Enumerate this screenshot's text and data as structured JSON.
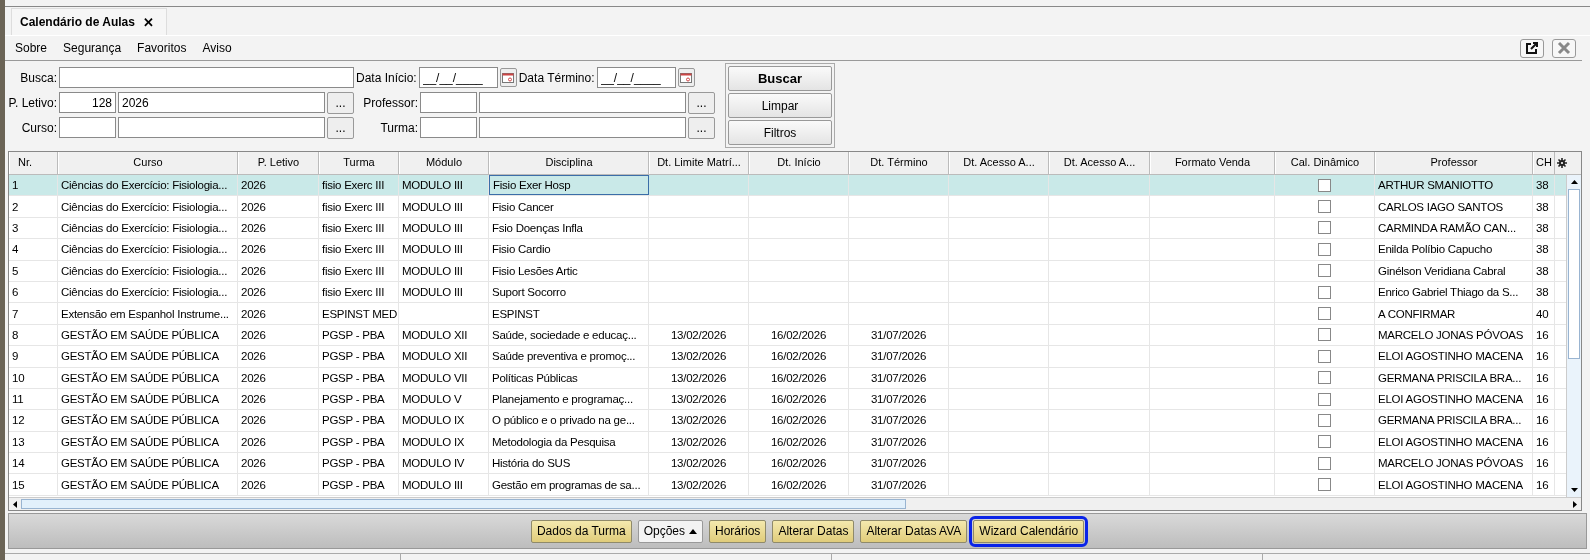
{
  "tab": {
    "title": "Calendário de Aulas",
    "close": "✕",
    "selected": true
  },
  "menu": [
    "Sobre",
    "Segurança",
    "Favoritos",
    "Aviso"
  ],
  "form": {
    "busca": {
      "label": "Busca:"
    },
    "data_inicio": {
      "label": "Data Início:",
      "value": "__/__/____"
    },
    "data_termino": {
      "label": "Data Término:",
      "value": "__/__/____"
    },
    "letivo": {
      "label": "P. Letivo:",
      "code": "128",
      "name": "2026",
      "browse": "..."
    },
    "professor": {
      "label": "Professor:",
      "browse": "..."
    },
    "curso": {
      "label": "Curso:",
      "browse": "..."
    },
    "turma": {
      "label": "Turma:",
      "browse": "..."
    }
  },
  "search_buttons": [
    {
      "label": "Buscar",
      "default": true
    },
    {
      "label": "Limpar",
      "default": false
    },
    {
      "label": "Filtros",
      "default": false
    }
  ],
  "table": {
    "columns": [
      "Nr.",
      "Curso",
      "P. Letivo",
      "Turma",
      "Módulo",
      "Disciplina",
      "Dt. Limite Matrí...",
      "Dt. Início",
      "Dt. Término",
      "Dt. Acesso A...",
      "Dt. Acesso A...",
      "Formato Venda",
      "Cal. Dinâmico",
      "Professor",
      "CH"
    ],
    "rows": [
      {
        "nr": "1",
        "curso": "Ciências do Exercício: Fisiologia...",
        "letivo": "2026",
        "turma": "fisio Exerc III",
        "modulo": "MODULO III",
        "disciplina": "Fisio Exer Hosp",
        "cal_dinamico": false,
        "professor": "ARTHUR SMANIOTTO",
        "ch": "38",
        "selected": true
      },
      {
        "nr": "2",
        "curso": "Ciências do Exercício: Fisiologia...",
        "letivo": "2026",
        "turma": "fisio Exerc III",
        "modulo": "MODULO III",
        "disciplina": "Fisio Cancer",
        "cal_dinamico": false,
        "professor": "CARLOS IAGO SANTOS",
        "ch": "38",
        "selected": false
      },
      {
        "nr": "3",
        "curso": "Ciências do Exercício: Fisiologia...",
        "letivo": "2026",
        "turma": "fisio Exerc III",
        "modulo": "MODULO III",
        "disciplina": "Fsio Doenças Infla",
        "cal_dinamico": false,
        "professor": "CARMINDA RAMÃO CAN...",
        "ch": "38",
        "selected": false
      },
      {
        "nr": "4",
        "curso": "Ciências do Exercício: Fisiologia...",
        "letivo": "2026",
        "turma": "fisio Exerc III",
        "modulo": "MODULO III",
        "disciplina": "Fisio Cardio",
        "cal_dinamico": false,
        "professor": "Enilda Políbio Capucho",
        "ch": "38",
        "selected": false
      },
      {
        "nr": "5",
        "curso": "Ciências do Exercício: Fisiologia...",
        "letivo": "2026",
        "turma": "fisio Exerc III",
        "modulo": "MODULO III",
        "disciplina": "Fisio Lesões Artic",
        "cal_dinamico": false,
        "professor": "Ginélson Veridiana Cabral",
        "ch": "38",
        "selected": false
      },
      {
        "nr": "6",
        "curso": "Ciências do Exercício: Fisiologia...",
        "letivo": "2026",
        "turma": "fisio Exerc III",
        "modulo": "MODULO III",
        "disciplina": "Suport Socorro",
        "cal_dinamico": false,
        "professor": "Enrico Gabriel Thiago da S...",
        "ch": "38",
        "selected": false
      },
      {
        "nr": "7",
        "curso": "Extensão em Espanhol Instrume...",
        "letivo": "2026",
        "turma": "ESPINST MED",
        "disciplina": "ESPINST",
        "cal_dinamico": false,
        "professor": "A CONFIRMAR",
        "ch": "40",
        "selected": false
      },
      {
        "nr": "8",
        "curso": "GESTÃO EM SAÚDE PÚBLICA",
        "letivo": "2026",
        "turma": "PGSP - PBA",
        "modulo": "MODULO XII",
        "disciplina": "Saúde, sociedade e educaç...",
        "limite": "13/02/2026",
        "inicio": "16/02/2026",
        "termino": "31/07/2026",
        "cal_dinamico": false,
        "professor": "MARCELO JONAS PÓVOAS",
        "ch": "16",
        "selected": false
      },
      {
        "nr": "9",
        "curso": "GESTÃO EM SAÚDE PÚBLICA",
        "letivo": "2026",
        "turma": "PGSP - PBA",
        "modulo": "MODULO XII",
        "disciplina": "Saúde preventiva e promoç...",
        "limite": "13/02/2026",
        "inicio": "16/02/2026",
        "termino": "31/07/2026",
        "cal_dinamico": false,
        "professor": "ELOI AGOSTINHO MACENA",
        "ch": "16",
        "selected": false
      },
      {
        "nr": "10",
        "curso": "GESTÃO EM SAÚDE PÚBLICA",
        "letivo": "2026",
        "turma": "PGSP - PBA",
        "modulo": "MODULO VII",
        "disciplina": "Políticas Públicas",
        "limite": "13/02/2026",
        "inicio": "16/02/2026",
        "termino": "31/07/2026",
        "cal_dinamico": false,
        "professor": "GERMANA PRISCILA BRA...",
        "ch": "16",
        "selected": false
      },
      {
        "nr": "11",
        "curso": "GESTÃO EM SAÚDE PÚBLICA",
        "letivo": "2026",
        "turma": "PGSP - PBA",
        "modulo": "MODULO V",
        "disciplina": "Planejamento e programaç...",
        "limite": "13/02/2026",
        "inicio": "16/02/2026",
        "termino": "31/07/2026",
        "cal_dinamico": false,
        "professor": "ELOI AGOSTINHO MACENA",
        "ch": "16",
        "selected": false
      },
      {
        "nr": "12",
        "curso": "GESTÃO EM SAÚDE PÚBLICA",
        "letivo": "2026",
        "turma": "PGSP - PBA",
        "modulo": "MODULO IX",
        "disciplina": "O público e o privado na ge...",
        "limite": "13/02/2026",
        "inicio": "16/02/2026",
        "termino": "31/07/2026",
        "cal_dinamico": false,
        "professor": "GERMANA PRISCILA BRA...",
        "ch": "16",
        "selected": false
      },
      {
        "nr": "13",
        "curso": "GESTÃO EM SAÚDE PÚBLICA",
        "letivo": "2026",
        "turma": "PGSP - PBA",
        "modulo": "MODULO IX",
        "disciplina": "Metodologia da Pesquisa",
        "limite": "13/02/2026",
        "inicio": "16/02/2026",
        "termino": "31/07/2026",
        "cal_dinamico": false,
        "professor": "ELOI AGOSTINHO MACENA",
        "ch": "16",
        "selected": false
      },
      {
        "nr": "14",
        "curso": "GESTÃO EM SAÚDE PÚBLICA",
        "letivo": "2026",
        "turma": "PGSP - PBA",
        "modulo": "MODULO IV",
        "disciplina": "História do SUS",
        "limite": "13/02/2026",
        "inicio": "16/02/2026",
        "termino": "31/07/2026",
        "cal_dinamico": false,
        "professor": "MARCELO JONAS PÓVOAS",
        "ch": "16",
        "selected": false
      },
      {
        "nr": "15",
        "curso": "GESTÃO EM SAÚDE PÚBLICA",
        "letivo": "2026",
        "turma": "PGSP - PBA",
        "modulo": "MODULO III",
        "disciplina": "Gestão em programas de sa...",
        "limite": "13/02/2026",
        "inicio": "16/02/2026",
        "termino": "31/07/2026",
        "cal_dinamico": false,
        "professor": "ELOI AGOSTINHO MACENA",
        "ch": "16",
        "selected": false
      }
    ]
  },
  "toolbar": [
    {
      "label": "Dados da Turma",
      "kind": "action",
      "focused": false
    },
    {
      "label": "Opções",
      "kind": "menu",
      "focused": false
    },
    {
      "label": "Horários",
      "kind": "action",
      "focused": false
    },
    {
      "label": "Alterar Datas",
      "kind": "action",
      "focused": false
    },
    {
      "label": "Alterar Datas AVA",
      "kind": "action",
      "focused": false
    },
    {
      "label": "Wizard Calendário",
      "kind": "action",
      "focused": true
    }
  ]
}
